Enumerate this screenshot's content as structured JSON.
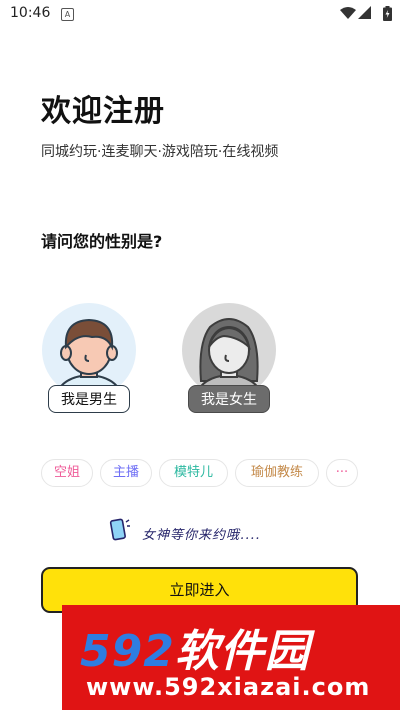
{
  "status_bar": {
    "time": "10:46",
    "notification_letter": "A"
  },
  "register": {
    "title": "欢迎注册",
    "subtitle": "同城约玩·连麦聊天·游戏陪玩·在线视频",
    "question": "请问您的性别是?"
  },
  "gender_options": [
    {
      "label": "我是男生",
      "selected": true
    },
    {
      "label": "我是女生",
      "selected": false
    }
  ],
  "tags": [
    {
      "label": "空姐",
      "color": "#ef5b98"
    },
    {
      "label": "主播",
      "color": "#6f6ff5"
    },
    {
      "label": "模特儿",
      "color": "#2bb8a0"
    },
    {
      "label": "瑜伽教练",
      "color": "#c48a4a"
    },
    {
      "label": "···",
      "color": "#ef5b98"
    }
  ],
  "slogan": "女神等你来约哦....",
  "enter_button_label": "立即进入",
  "watermark": {
    "brand_digits": "592",
    "brand_text": "软件园",
    "url": "www.592xiazai.com"
  },
  "colors": {
    "accent_yellow": "#ffe10a",
    "watermark_red": "#e01414",
    "watermark_blue": "#2f7de1"
  }
}
